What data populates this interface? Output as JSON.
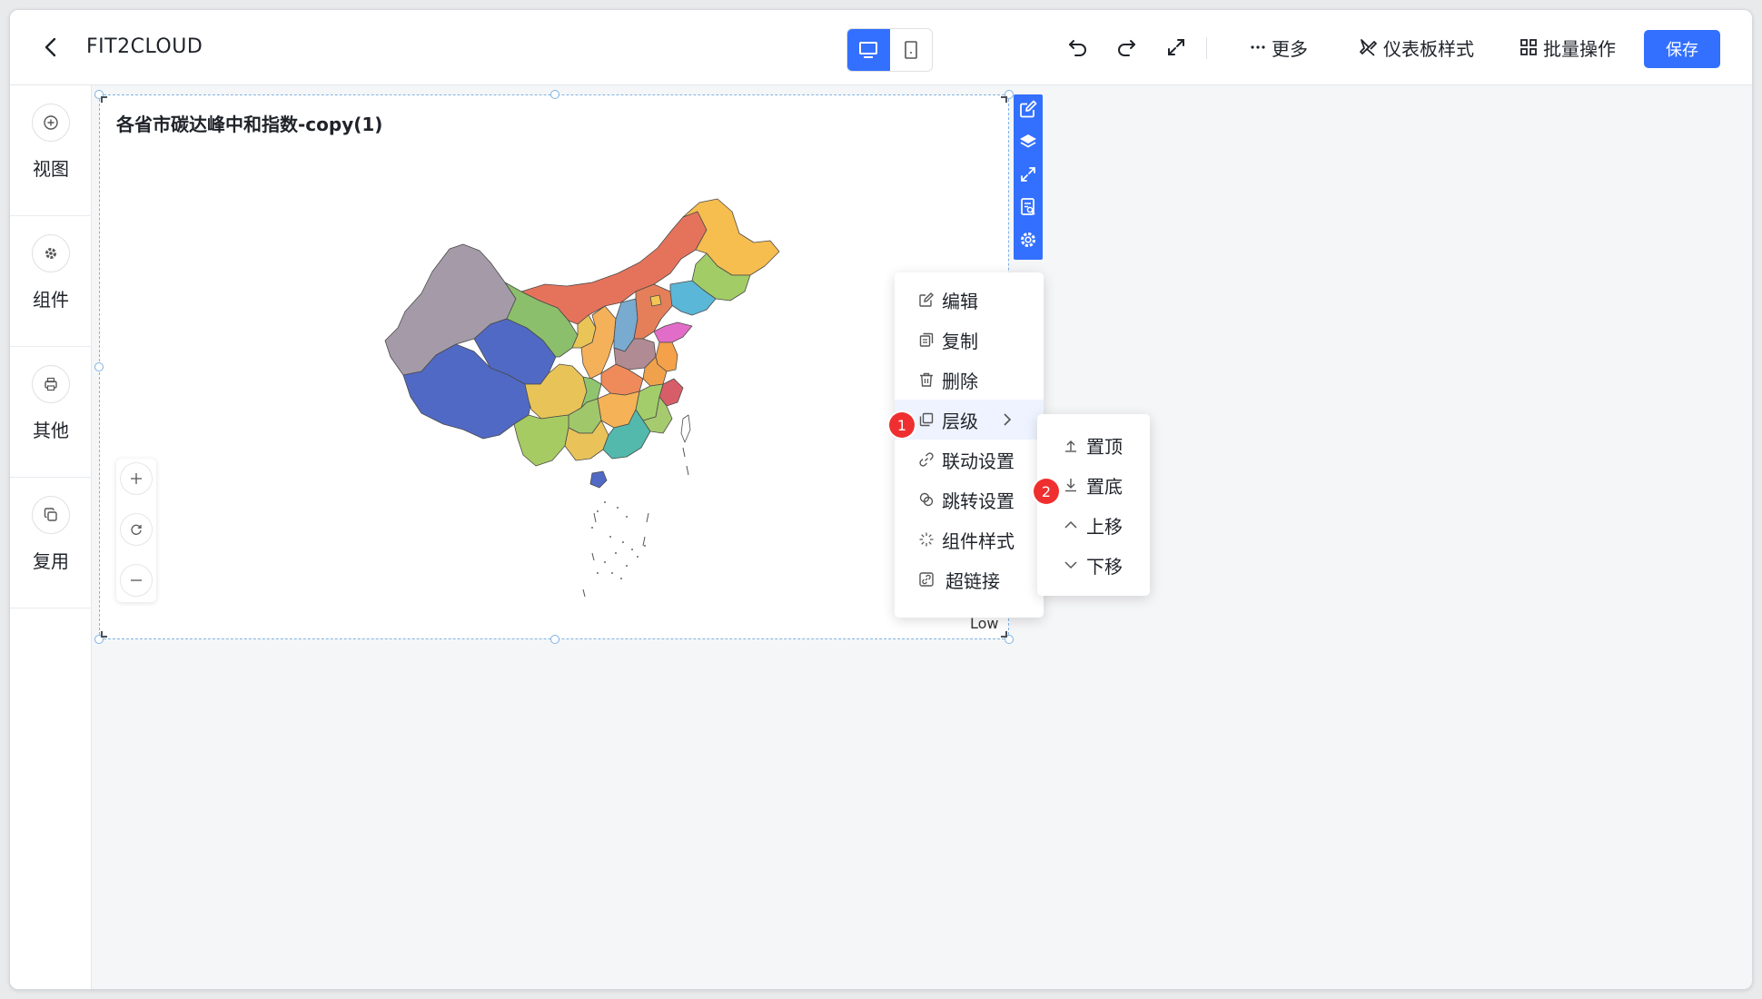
{
  "header": {
    "title": "FIT2CLOUD",
    "more_label": "更多",
    "dashboard_style_label": "仪表板样式",
    "batch_label": "批量操作",
    "save_label": "保存",
    "accent_color": "#3370ff"
  },
  "sidebar": {
    "items": [
      {
        "label": "视图",
        "icon": "plus-circle-icon"
      },
      {
        "label": "组件",
        "icon": "gear-icon"
      },
      {
        "label": "其他",
        "icon": "print-icon"
      },
      {
        "label": "复用",
        "icon": "copy-icon"
      }
    ]
  },
  "component": {
    "title": "各省市碳达峰中和指数-copy(1)",
    "legend_low": "Low"
  },
  "context_menu": {
    "items": [
      {
        "label": "编辑",
        "icon": "edit-icon"
      },
      {
        "label": "复制",
        "icon": "copy-icon"
      },
      {
        "label": "删除",
        "icon": "trash-icon"
      },
      {
        "label": "层级",
        "icon": "layers-icon"
      },
      {
        "label": "联动设置",
        "icon": "link-icon"
      },
      {
        "label": "跳转设置",
        "icon": "jump-icon"
      },
      {
        "label": "组件样式",
        "icon": "style-icon"
      },
      {
        "label": "超链接",
        "icon": "hyperlink-icon"
      }
    ],
    "badge1": "1"
  },
  "submenu": {
    "items": [
      {
        "label": "置顶",
        "icon": "arrow-top-icon"
      },
      {
        "label": "置底",
        "icon": "arrow-bottom-icon"
      },
      {
        "label": "上移",
        "icon": "chevron-up-icon"
      },
      {
        "label": "下移",
        "icon": "chevron-down-icon"
      }
    ],
    "badge2": "2"
  }
}
